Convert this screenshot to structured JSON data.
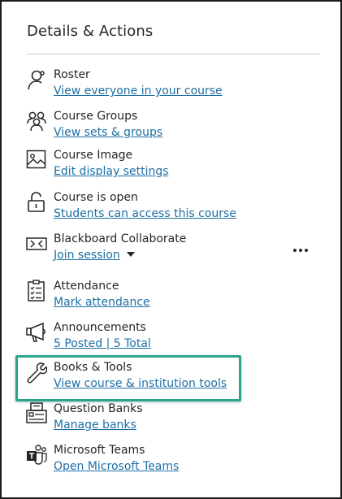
{
  "panel": {
    "title": "Details & Actions"
  },
  "items": [
    {
      "icon": "roster-icon",
      "label": "Roster",
      "link": "View everyone in your course"
    },
    {
      "icon": "groups-icon",
      "label": "Course Groups",
      "link": "View sets & groups"
    },
    {
      "icon": "image-icon",
      "label": "Course Image",
      "link": "Edit display settings"
    },
    {
      "icon": "unlock-icon",
      "label": "Course is open",
      "link": "Students can access this course"
    },
    {
      "icon": "video-icon",
      "label": "Blackboard Collaborate",
      "link": "Join session"
    },
    {
      "icon": "attendance-icon",
      "label": "Attendance",
      "link": "Mark attendance"
    },
    {
      "icon": "megaphone-icon",
      "label": "Announcements",
      "link": "5 Posted | 5 Total"
    },
    {
      "icon": "wrench-icon",
      "label": "Books & Tools",
      "link": "View course & institution tools"
    },
    {
      "icon": "question-bank-icon",
      "label": "Question Banks",
      "link": "Manage banks"
    },
    {
      "icon": "teams-icon",
      "label": "Microsoft Teams",
      "link": "Open Microsoft Teams"
    }
  ],
  "colors": {
    "link": "#1d6fa5",
    "highlight": "#2aa58c",
    "text": "#262626"
  }
}
